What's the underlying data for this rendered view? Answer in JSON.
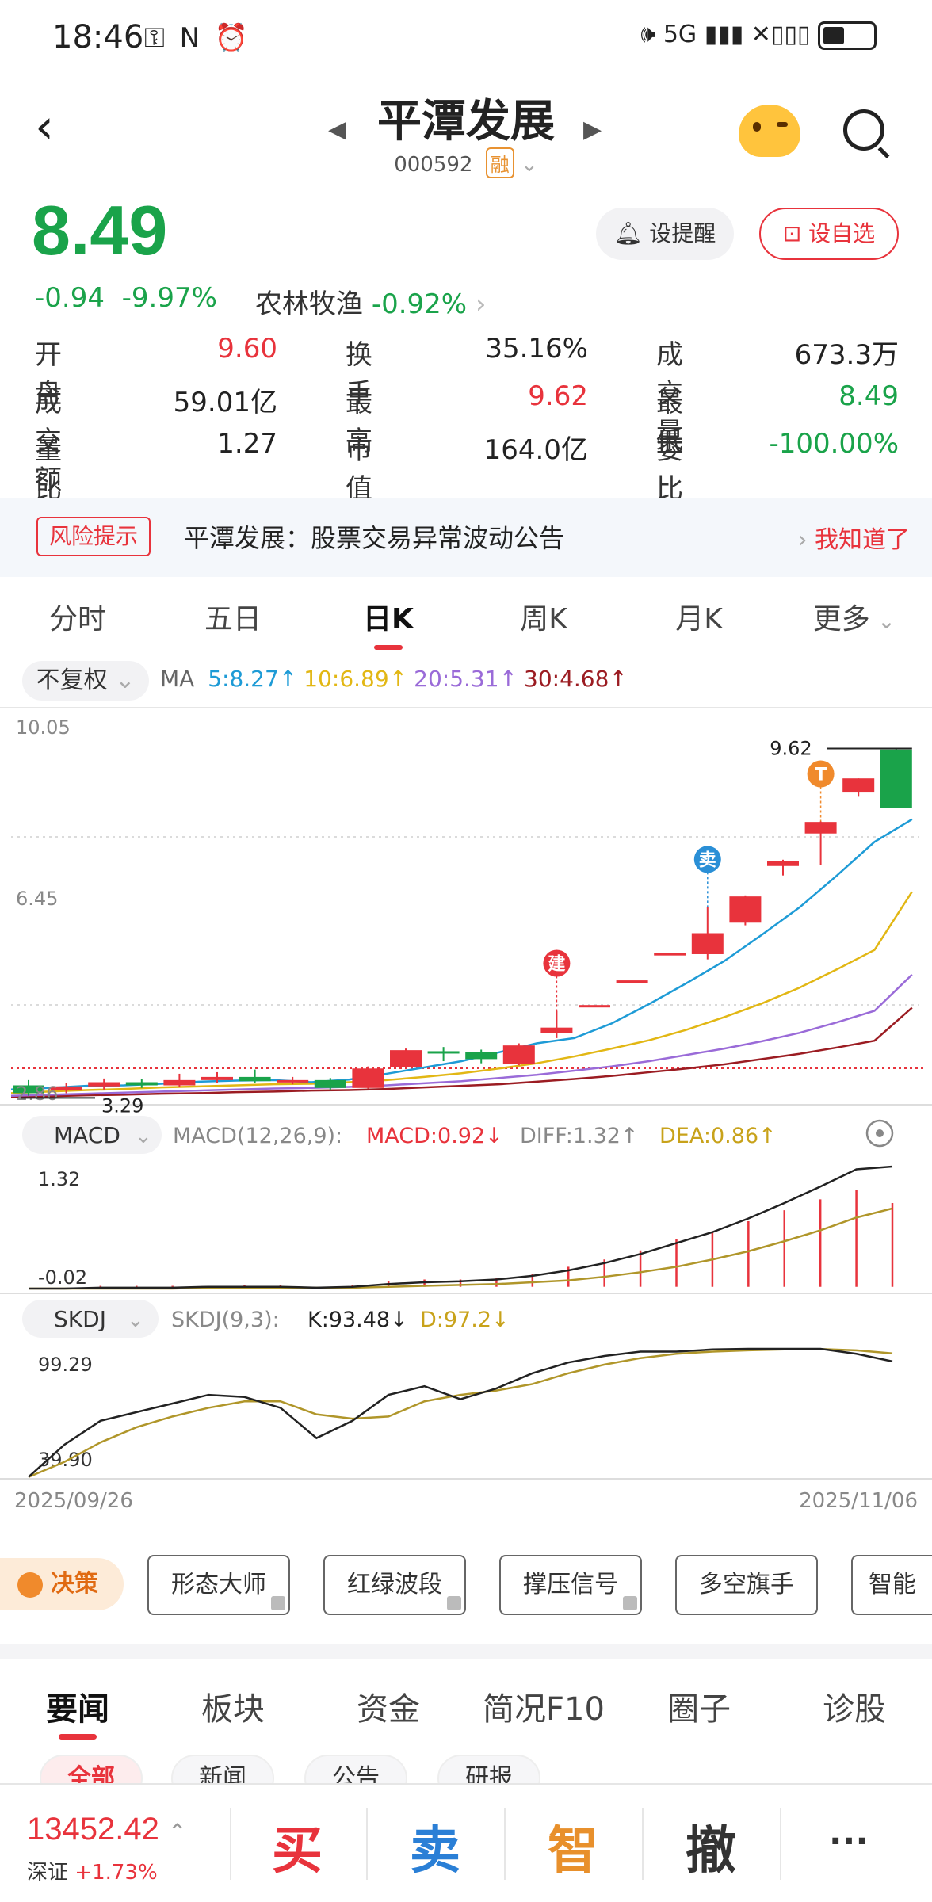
{
  "status_bar": {
    "time": "18:46",
    "icons": "⚿ N ⏰",
    "signal": "🕪 5G ▮▮▮ ✕▯▯▯"
  },
  "header": {
    "stock_name": "平潭发展",
    "stock_code": "000592",
    "margin_badge": "融"
  },
  "quote": {
    "price": "8.49",
    "change": "-0.94",
    "change_pct": "-9.97%",
    "sector": "农林牧渔",
    "sector_change": "-0.92%",
    "remind_label": "设提醒",
    "watch_label": "设自选",
    "fields": [
      [
        {
          "label": "开盘",
          "value": "9.60",
          "color": "#e8333c"
        },
        {
          "label": "换手",
          "value": "35.16%",
          "color": "#222222"
        },
        {
          "label": "成交量",
          "value": "673.3万",
          "color": "#222222"
        }
      ],
      [
        {
          "label": "成交额",
          "value": "59.01亿",
          "color": "#222222"
        },
        {
          "label": "最高",
          "value": "9.62",
          "color": "#e8333c"
        },
        {
          "label": "最低",
          "value": "8.49",
          "color": "#1aa34a"
        }
      ],
      [
        {
          "label": "量比",
          "value": "1.27",
          "color": "#222222"
        },
        {
          "label": "市值",
          "value": "164.0亿",
          "color": "#222222"
        },
        {
          "label": "委比",
          "value": "-100.00%",
          "color": "#1aa34a"
        }
      ]
    ]
  },
  "risk": {
    "tag": "风险提示",
    "text": "平潭发展：股票交易异常波动公告",
    "ack": "我知道了"
  },
  "tabs": [
    "分时",
    "五日",
    "日K",
    "周K",
    "月K",
    "更多"
  ],
  "toolbar": {
    "adjust": "不复权",
    "ma_label": "MA",
    "ma": [
      {
        "text": "5:8.27↑",
        "color": "#1e9bd6"
      },
      {
        "text": "10:6.89↑",
        "color": "#e2b714"
      },
      {
        "text": "20:5.31↑",
        "color": "#9a6bd8"
      },
      {
        "text": "30:4.68↑",
        "color": "#9b1c22"
      }
    ]
  },
  "chart_data": {
    "type": "candlestick",
    "price_axis": {
      "max_label": "10.05",
      "mid_label": "6.45",
      "min_label": "2.86",
      "ylim": [
        2.86,
        10.05
      ]
    },
    "high_marker": "9.62",
    "low_marker": "3.29",
    "signals": [
      {
        "label": "建",
        "index": 14
      },
      {
        "label": "卖",
        "index": 18
      },
      {
        "label": "T",
        "index": 21
      }
    ],
    "candles": [
      {
        "o": 3.2,
        "c": 3.05,
        "h": 3.3,
        "l": 3.0
      },
      {
        "o": 3.1,
        "c": 3.18,
        "h": 3.25,
        "l": 3.05
      },
      {
        "o": 3.18,
        "c": 3.26,
        "h": 3.33,
        "l": 3.12
      },
      {
        "o": 3.26,
        "c": 3.2,
        "h": 3.32,
        "l": 3.15
      },
      {
        "o": 3.2,
        "c": 3.3,
        "h": 3.42,
        "l": 3.17
      },
      {
        "o": 3.3,
        "c": 3.36,
        "h": 3.45,
        "l": 3.25
      },
      {
        "o": 3.36,
        "c": 3.28,
        "h": 3.5,
        "l": 3.24
      },
      {
        "o": 3.28,
        "c": 3.3,
        "h": 3.36,
        "l": 3.22
      },
      {
        "o": 3.3,
        "c": 3.15,
        "h": 3.34,
        "l": 3.1
      },
      {
        "o": 3.15,
        "c": 3.52,
        "h": 3.56,
        "l": 3.14
      },
      {
        "o": 3.55,
        "c": 3.87,
        "h": 3.9,
        "l": 3.52
      },
      {
        "o": 3.85,
        "c": 3.82,
        "h": 3.93,
        "l": 3.66
      },
      {
        "o": 3.84,
        "c": 3.7,
        "h": 3.88,
        "l": 3.62
      },
      {
        "o": 3.6,
        "c": 3.96,
        "h": 4.0,
        "l": 3.58
      },
      {
        "o": 4.2,
        "c": 4.3,
        "h": 4.62,
        "l": 4.1
      },
      {
        "o": 4.73,
        "c": 4.73,
        "h": 4.73,
        "l": 4.73
      },
      {
        "o": 5.2,
        "c": 5.2,
        "h": 5.2,
        "l": 5.2
      },
      {
        "o": 5.72,
        "c": 5.72,
        "h": 5.72,
        "l": 5.72
      },
      {
        "o": 5.7,
        "c": 6.1,
        "h": 6.6,
        "l": 5.6
      },
      {
        "o": 6.3,
        "c": 6.8,
        "h": 6.82,
        "l": 6.25
      },
      {
        "o": 7.38,
        "c": 7.48,
        "h": 7.5,
        "l": 7.2
      },
      {
        "o": 8.0,
        "c": 8.22,
        "h": 8.23,
        "l": 7.4
      },
      {
        "o": 8.78,
        "c": 9.05,
        "h": 9.05,
        "l": 8.7
      },
      {
        "o": 9.6,
        "c": 8.49,
        "h": 9.62,
        "l": 8.49
      }
    ],
    "ma5": [
      3.12,
      3.15,
      3.19,
      3.2,
      3.23,
      3.27,
      3.29,
      3.3,
      3.26,
      3.31,
      3.42,
      3.54,
      3.66,
      3.83,
      4.0,
      4.1,
      4.38,
      4.75,
      5.15,
      5.57,
      6.07,
      6.59,
      7.2,
      7.84,
      8.27
    ],
    "ma10": [
      3.05,
      3.08,
      3.11,
      3.13,
      3.16,
      3.18,
      3.2,
      3.22,
      3.23,
      3.26,
      3.3,
      3.36,
      3.43,
      3.52,
      3.62,
      3.75,
      3.9,
      4.06,
      4.26,
      4.5,
      4.76,
      5.06,
      5.41,
      5.78,
      6.89
    ],
    "ma20": [
      3.0,
      3.02,
      3.04,
      3.06,
      3.08,
      3.1,
      3.12,
      3.14,
      3.15,
      3.17,
      3.2,
      3.24,
      3.28,
      3.34,
      3.4,
      3.48,
      3.56,
      3.66,
      3.78,
      3.9,
      4.04,
      4.2,
      4.4,
      4.62,
      5.31
    ],
    "ma30": [
      2.98,
      2.99,
      3.01,
      3.02,
      3.04,
      3.05,
      3.07,
      3.08,
      3.1,
      3.11,
      3.13,
      3.16,
      3.19,
      3.22,
      3.27,
      3.32,
      3.38,
      3.45,
      3.52,
      3.6,
      3.7,
      3.8,
      3.92,
      4.05,
      4.68
    ],
    "macd": {
      "label": "MACD",
      "params": "MACD(12,26,9):",
      "macd_text": "MACD:0.92↓",
      "diff_text": "DIFF:1.32↑",
      "dea_text": "DEA:0.86↑",
      "max_label": "1.32",
      "min_label": "-0.02",
      "diff": [
        -0.02,
        -0.02,
        -0.01,
        -0.01,
        -0.01,
        0.0,
        0.0,
        0.0,
        -0.01,
        0.0,
        0.03,
        0.05,
        0.06,
        0.08,
        0.12,
        0.18,
        0.26,
        0.36,
        0.48,
        0.6,
        0.75,
        0.92,
        1.1,
        1.29,
        1.32
      ],
      "dea": [
        -0.02,
        -0.02,
        -0.02,
        -0.02,
        -0.02,
        -0.01,
        -0.01,
        -0.01,
        -0.01,
        -0.01,
        0.0,
        0.01,
        0.02,
        0.03,
        0.05,
        0.07,
        0.11,
        0.16,
        0.22,
        0.3,
        0.39,
        0.5,
        0.62,
        0.76,
        0.86
      ],
      "bars": [
        0.0,
        0.0,
        0.01,
        0.01,
        0.01,
        0.01,
        0.02,
        0.02,
        0.0,
        0.02,
        0.06,
        0.08,
        0.08,
        0.1,
        0.14,
        0.22,
        0.3,
        0.4,
        0.52,
        0.6,
        0.72,
        0.84,
        0.96,
        1.06,
        0.92
      ]
    },
    "skdj": {
      "label": "SKDJ",
      "params": "SKDJ(9,3):",
      "k_text": "K:93.48↓",
      "d_text": "D:97.2↓",
      "max_label": "99.29",
      "min_label": "39.90",
      "k": [
        40,
        55,
        66,
        70,
        74,
        78,
        77,
        72,
        58,
        66,
        78,
        82,
        76,
        81,
        88,
        93,
        96,
        98,
        98,
        99,
        99.3,
        99.3,
        99.3,
        97,
        93.48
      ],
      "d": [
        40,
        47,
        56,
        63,
        68,
        72,
        75,
        75,
        69,
        67,
        68,
        75,
        78,
        80,
        83,
        88,
        92,
        95,
        97,
        98,
        98.6,
        99,
        99.2,
        98.6,
        97.2
      ]
    },
    "x_start": "2025/09/26",
    "x_end": "2025/11/06"
  },
  "decision": {
    "label": "决策",
    "tools": [
      "形态大师",
      "红绿波段",
      "撑压信号",
      "多空旗手",
      "智能"
    ]
  },
  "news_tabs": [
    "要闻",
    "板块",
    "资金",
    "简况F10",
    "圈子",
    "诊股"
  ],
  "news_chips": [
    "全部",
    "新闻",
    "公告",
    "研报"
  ],
  "bottom": {
    "index_value": "13452.42",
    "index_name": "深证",
    "index_change": "+1.73%",
    "buy": "买",
    "sell": "卖",
    "smart": "智",
    "cancel": "撤",
    "more": "···"
  }
}
